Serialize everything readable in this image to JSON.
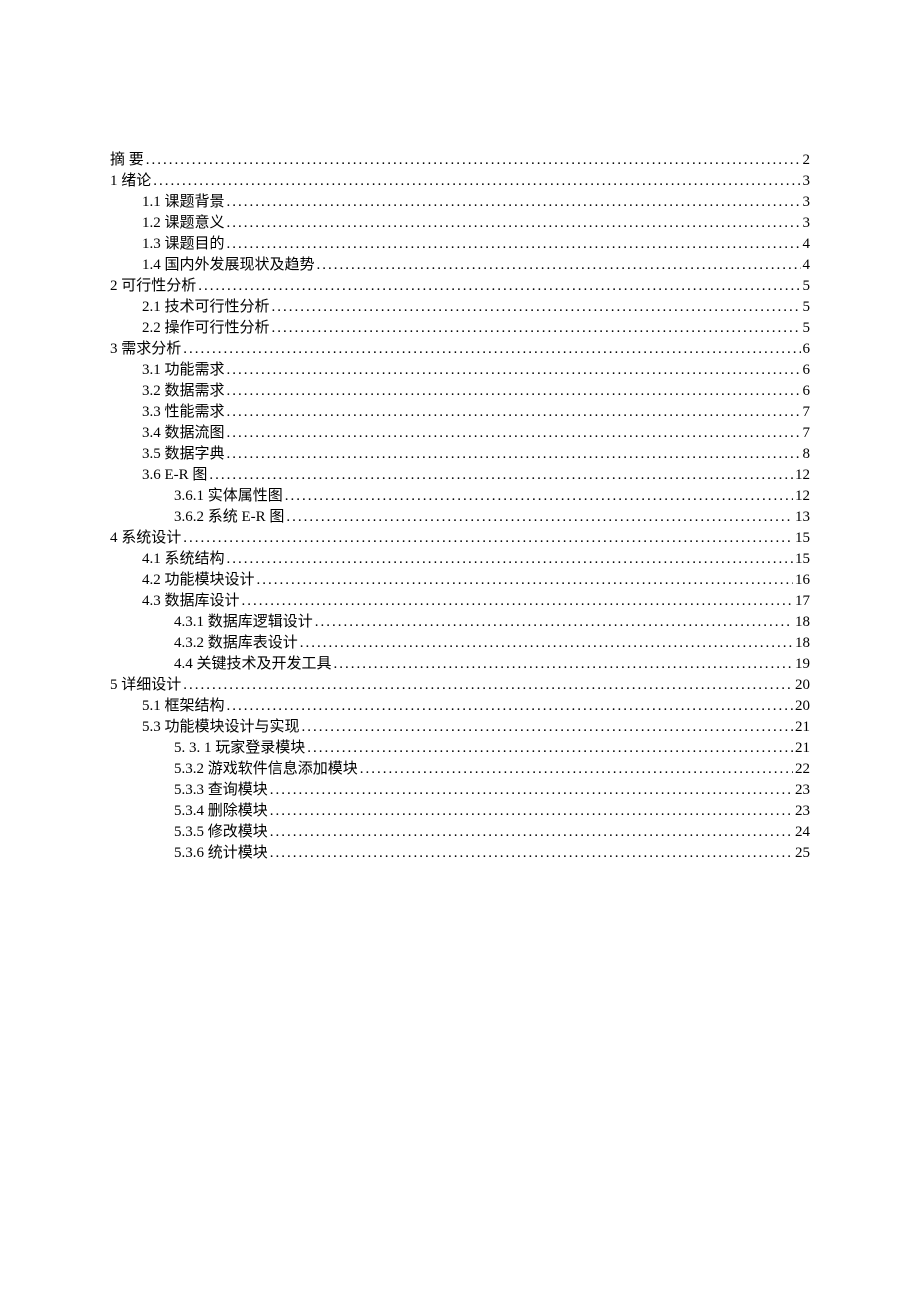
{
  "toc": [
    {
      "label": "摘    要",
      "page": "2",
      "indent": 0
    },
    {
      "label": "1  绪论",
      "page": "3",
      "indent": 0
    },
    {
      "label": "1.1 课题背景",
      "page": "3",
      "indent": 1
    },
    {
      "label": "1.2 课题意义",
      "page": "3",
      "indent": 1
    },
    {
      "label": "1.3 课题目的",
      "page": "4",
      "indent": 1
    },
    {
      "label": "1.4 国内外发展现状及趋势",
      "page": "4",
      "indent": 1
    },
    {
      "label": "2  可行性分析",
      "page": "5",
      "indent": 0
    },
    {
      "label": "2.1 技术可行性分析",
      "page": "5",
      "indent": 1
    },
    {
      "label": "2.2 操作可行性分析",
      "page": "5",
      "indent": 1
    },
    {
      "label": "3  需求分析",
      "page": "6",
      "indent": 0
    },
    {
      "label": "3.1 功能需求",
      "page": "6",
      "indent": 1
    },
    {
      "label": "3.2 数据需求",
      "page": "6",
      "indent": 1
    },
    {
      "label": "3.3 性能需求",
      "page": "7",
      "indent": 1
    },
    {
      "label": "3.4 数据流图",
      "page": "7",
      "indent": 1
    },
    {
      "label": "3.5 数据字典",
      "page": "8",
      "indent": 1
    },
    {
      "label": "3.6 E-R 图",
      "page": "12",
      "indent": 1
    },
    {
      "label": "3.6.1  实体属性图",
      "page": "12",
      "indent": 2
    },
    {
      "label": "3.6.2 系统 E-R 图",
      "page": "13",
      "indent": 2
    },
    {
      "label": "4 系统设计",
      "page": "15",
      "indent": 0
    },
    {
      "label": "4.1 系统结构",
      "page": "15",
      "indent": 1
    },
    {
      "label": "4.2 功能模块设计",
      "page": "16",
      "indent": 1
    },
    {
      "label": "4.3 数据库设计",
      "page": "17",
      "indent": 1
    },
    {
      "label": "4.3.1 数据库逻辑设计",
      "page": "18",
      "indent": 2
    },
    {
      "label": "4.3.2 数据库表设计",
      "page": "18",
      "indent": 2
    },
    {
      "label": "4.4 关键技术及开发工具",
      "page": "19",
      "indent": 2
    },
    {
      "label": "5 详细设计",
      "page": "20",
      "indent": 0
    },
    {
      "label": "5.1  框架结构",
      "page": "20",
      "indent": 1
    },
    {
      "label": "5.3 功能模块设计与实现",
      "page": "21",
      "indent": 1
    },
    {
      "label": "5. 3. 1 玩家登录模块",
      "page": "21",
      "indent": 2
    },
    {
      "label": "5.3.2 游戏软件信息添加模块",
      "page": "22",
      "indent": 2
    },
    {
      "label": "5.3.3 查询模块",
      "page": "23",
      "indent": 2
    },
    {
      "label": "5.3.4 删除模块",
      "page": "23",
      "indent": 2
    },
    {
      "label": "5.3.5 修改模块",
      "page": "24",
      "indent": 2
    },
    {
      "label": "5.3.6 统计模块",
      "page": "25",
      "indent": 2
    }
  ]
}
